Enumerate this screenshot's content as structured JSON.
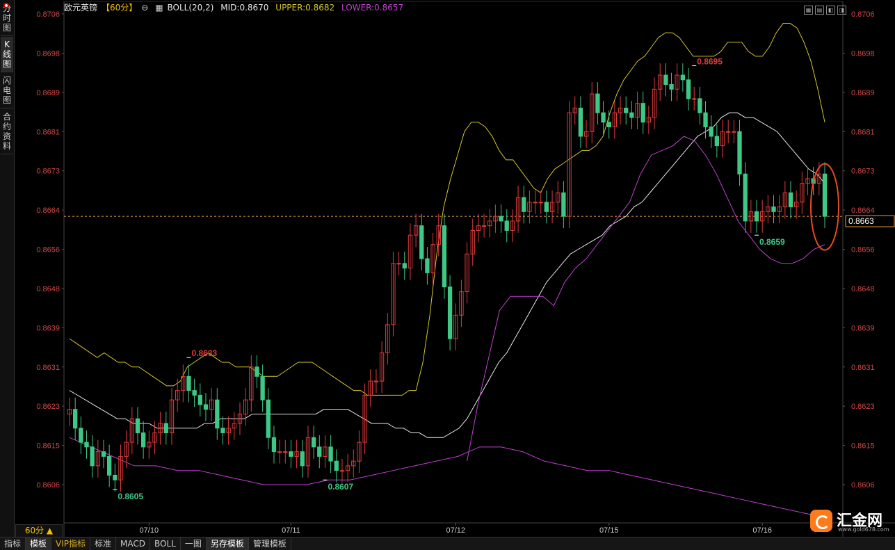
{
  "sidebar": {
    "tabs": [
      {
        "label": "分时图"
      },
      {
        "label": "K线图",
        "active": true
      },
      {
        "label": "闪电图"
      },
      {
        "label": "合约资料"
      }
    ]
  },
  "header": {
    "title": "欧元英镑",
    "period": "【60分】",
    "indicator": "BOLL(20,2)",
    "mid": "MID:0.8670",
    "upper": "UPPER:0.8682",
    "lower": "LOWER:0.8657"
  },
  "period_box": "60分 ▲",
  "bottom_tabs": [
    {
      "label": "指标",
      "selected": false
    },
    {
      "label": "模板",
      "selected": true
    },
    {
      "label": "VIP指标",
      "vip": true
    },
    {
      "label": "标准",
      "selected": false
    },
    {
      "label": "MACD",
      "selected": false
    },
    {
      "label": "BOLL",
      "selected": false
    },
    {
      "label": "一图",
      "selected": false
    },
    {
      "label": "另存模板",
      "selected": true
    },
    {
      "label": "管理模板",
      "selected": false
    }
  ],
  "logo": {
    "text": "汇金网",
    "url": "www.gold678.com"
  },
  "colors": {
    "up": "#e03c3c",
    "down": "#3ec886",
    "upper": "#d6c62a",
    "mid": "#e8e8e8",
    "lower": "#c040d0",
    "axis_text": "#d04848",
    "current_line": "#f0a040",
    "highlight": "#e84a20"
  },
  "chart_data": {
    "type": "candlestick",
    "title": "欧元英镑【60分】",
    "ylim": [
      0.86,
      0.8707
    ],
    "y_ticks": [
      "0.8706",
      "0.8698",
      "0.8689",
      "0.8681",
      "0.8673",
      "0.8664",
      "0.8656",
      "0.8648",
      "0.8639",
      "0.8631",
      "0.8623",
      "0.8615",
      "0.8606"
    ],
    "x_labels": [
      "07/10",
      "07/11",
      "07/12",
      "07/15",
      "07/16"
    ],
    "x_label_index": [
      14,
      39,
      68,
      95,
      122
    ],
    "current_price": "0.8663",
    "current_value": 0.8663,
    "annotations": [
      {
        "text": "0.8605",
        "index": 8,
        "value": 0.8605,
        "kind": "low"
      },
      {
        "text": "0.8633",
        "index": 21,
        "value": 0.8633,
        "kind": "high"
      },
      {
        "text": "0.8607",
        "index": 45,
        "value": 0.8607,
        "kind": "low"
      },
      {
        "text": "0.8695",
        "index": 110,
        "value": 0.8695,
        "kind": "high"
      },
      {
        "text": "0.8659",
        "index": 121,
        "value": 0.8659,
        "kind": "low"
      }
    ],
    "open": [
      0.8621,
      0.8622,
      0.8618,
      0.8615,
      0.8614,
      0.861,
      0.8613,
      0.8612,
      0.8608,
      0.8607,
      0.8612,
      0.8615,
      0.862,
      0.8617,
      0.8614,
      0.8615,
      0.8617,
      0.8619,
      0.8617,
      0.8624,
      0.8626,
      0.8629,
      0.8626,
      0.8625,
      0.8623,
      0.8622,
      0.8624,
      0.8618,
      0.8617,
      0.8618,
      0.8619,
      0.8621,
      0.8624,
      0.8631,
      0.8629,
      0.8624,
      0.8616,
      0.8613,
      0.8613,
      0.8613,
      0.8612,
      0.8613,
      0.861,
      0.8616,
      0.8614,
      0.8612,
      0.8614,
      0.8611,
      0.8609,
      0.8609,
      0.861,
      0.8611,
      0.8615,
      0.8625,
      0.8628,
      0.8628,
      0.8634,
      0.864,
      0.8653,
      0.8653,
      0.8652,
      0.8659,
      0.8661,
      0.8654,
      0.8651,
      0.8657,
      0.8661,
      0.8648,
      0.8637,
      0.8642,
      0.8647,
      0.8655,
      0.866,
      0.8661,
      0.8661,
      0.8662,
      0.8663,
      0.8662,
      0.866,
      0.8662,
      0.8667,
      0.8664,
      0.8666,
      0.8666,
      0.8666,
      0.8664,
      0.8666,
      0.8668,
      0.8663,
      0.8685,
      0.8686,
      0.868,
      0.8681,
      0.8689,
      0.8685,
      0.8683,
      0.8682,
      0.8685,
      0.8686,
      0.8685,
      0.8684,
      0.8687,
      0.8683,
      0.8684,
      0.869,
      0.8693,
      0.8691,
      0.869,
      0.8693,
      0.8692,
      0.8688,
      0.8688,
      0.8685,
      0.8682,
      0.868,
      0.8678,
      0.8681,
      0.8681,
      0.8681,
      0.8672,
      0.8662,
      0.8664,
      0.8662,
      0.8664,
      0.8665,
      0.8664,
      0.8665,
      0.8668,
      0.8665,
      0.8666,
      0.867,
      0.8671,
      0.867,
      0.8672
    ],
    "close": [
      0.8622,
      0.8618,
      0.8615,
      0.8614,
      0.861,
      0.8613,
      0.8612,
      0.8608,
      0.8607,
      0.8612,
      0.8615,
      0.862,
      0.8617,
      0.8614,
      0.8615,
      0.8617,
      0.8619,
      0.8617,
      0.8624,
      0.8626,
      0.8629,
      0.8626,
      0.8625,
      0.8623,
      0.8622,
      0.8624,
      0.8618,
      0.8617,
      0.8618,
      0.8619,
      0.8621,
      0.8624,
      0.8631,
      0.8629,
      0.8624,
      0.8616,
      0.8613,
      0.8613,
      0.8613,
      0.8612,
      0.8613,
      0.861,
      0.8616,
      0.8614,
      0.8612,
      0.8614,
      0.8611,
      0.8609,
      0.8609,
      0.861,
      0.8611,
      0.8615,
      0.8625,
      0.8628,
      0.8628,
      0.8634,
      0.864,
      0.8653,
      0.8653,
      0.8652,
      0.8659,
      0.8661,
      0.8654,
      0.8651,
      0.8657,
      0.8661,
      0.8648,
      0.8637,
      0.8642,
      0.8647,
      0.8655,
      0.866,
      0.8661,
      0.8661,
      0.8662,
      0.8663,
      0.8662,
      0.866,
      0.8662,
      0.8667,
      0.8664,
      0.8666,
      0.8666,
      0.8666,
      0.8664,
      0.8666,
      0.8668,
      0.8663,
      0.8685,
      0.8686,
      0.868,
      0.8681,
      0.8689,
      0.8685,
      0.8683,
      0.8682,
      0.8685,
      0.8686,
      0.8685,
      0.8684,
      0.8687,
      0.8683,
      0.8684,
      0.869,
      0.8693,
      0.8691,
      0.869,
      0.8693,
      0.8692,
      0.8688,
      0.8688,
      0.8685,
      0.8682,
      0.868,
      0.8678,
      0.8681,
      0.8681,
      0.8681,
      0.8672,
      0.8662,
      0.8664,
      0.8662,
      0.8664,
      0.8665,
      0.8664,
      0.8665,
      0.8668,
      0.8665,
      0.8666,
      0.867,
      0.8671,
      0.867,
      0.8672,
      0.8663
    ],
    "upper": [
      0.8637,
      0.8636,
      0.8635,
      0.8634,
      0.8633,
      0.8634,
      0.8633,
      0.8632,
      0.8632,
      0.8631,
      0.8631,
      0.863,
      0.8629,
      0.8628,
      0.8627,
      0.8627,
      0.8628,
      0.8631,
      0.8632,
      0.8633,
      0.8634,
      0.8633,
      0.8632,
      0.8632,
      0.8631,
      0.8631,
      0.8631,
      0.863,
      0.8629,
      0.8629,
      0.8629,
      0.863,
      0.8631,
      0.8632,
      0.8632,
      0.8632,
      0.8631,
      0.863,
      0.8629,
      0.8628,
      0.8627,
      0.8626,
      0.8626,
      0.8625,
      0.8625,
      0.8625,
      0.8625,
      0.8625,
      0.8625,
      0.8626,
      0.8626,
      0.8632,
      0.8642,
      0.8655,
      0.8665,
      0.8671,
      0.8676,
      0.8681,
      0.8683,
      0.8683,
      0.8682,
      0.868,
      0.8677,
      0.8675,
      0.8675,
      0.8673,
      0.8671,
      0.8669,
      0.8668,
      0.8671,
      0.8673,
      0.8674,
      0.8675,
      0.8676,
      0.8677,
      0.8677,
      0.8678,
      0.868,
      0.8685,
      0.8689,
      0.8692,
      0.8694,
      0.8696,
      0.8697,
      0.8699,
      0.8701,
      0.8702,
      0.8702,
      0.8701,
      0.8699,
      0.8697,
      0.8697,
      0.8697,
      0.8697,
      0.8698,
      0.87,
      0.87,
      0.87,
      0.8698,
      0.8697,
      0.8697,
      0.8699,
      0.8702,
      0.8704,
      0.8704,
      0.8703,
      0.87,
      0.8696,
      0.869,
      0.8683
    ],
    "mid": [
      0.8626,
      0.8625,
      0.8624,
      0.8623,
      0.8622,
      0.8621,
      0.862,
      0.862,
      0.8619,
      0.8619,
      0.8619,
      0.8618,
      0.8618,
      0.8618,
      0.8618,
      0.8618,
      0.8618,
      0.8619,
      0.8619,
      0.862,
      0.862,
      0.862,
      0.862,
      0.8621,
      0.8621,
      0.8621,
      0.8621,
      0.8621,
      0.8621,
      0.8621,
      0.8621,
      0.8621,
      0.8622,
      0.8622,
      0.8622,
      0.8622,
      0.8621,
      0.862,
      0.8619,
      0.8619,
      0.8619,
      0.8618,
      0.8618,
      0.8617,
      0.8617,
      0.8616,
      0.8616,
      0.8616,
      0.8617,
      0.8618,
      0.862,
      0.8623,
      0.8626,
      0.8629,
      0.8632,
      0.8634,
      0.8637,
      0.864,
      0.8643,
      0.8646,
      0.8649,
      0.8651,
      0.8653,
      0.8655,
      0.8656,
      0.8657,
      0.8658,
      0.8659,
      0.8661,
      0.8662,
      0.8663,
      0.8665,
      0.8666,
      0.8668,
      0.867,
      0.8672,
      0.8674,
      0.8676,
      0.8678,
      0.868,
      0.8681,
      0.8682,
      0.8684,
      0.8685,
      0.8685,
      0.8684,
      0.8684,
      0.8683,
      0.8682,
      0.8681,
      0.8679,
      0.8677,
      0.8675,
      0.8673,
      0.8672,
      0.867
    ],
    "lower": [
      0.8616,
      0.8614,
      0.8612,
      0.861,
      0.861,
      0.8609,
      0.8609,
      0.8608,
      0.8607,
      0.8606,
      0.8606,
      0.8606,
      0.8607,
      0.8607,
      0.8608,
      0.8609,
      0.861,
      0.8611,
      0.8612,
      0.8614,
      0.8614,
      0.8613,
      0.8611,
      0.861,
      0.8609,
      0.8609,
      0.8608,
      0.8607,
      0.8606,
      0.8605,
      0.8604,
      0.8603,
      0.8602,
      0.8601,
      0.86,
      0.8599,
      0.8611,
      0.8623,
      0.8633,
      0.8643,
      0.8646,
      0.8646,
      0.8646,
      0.8646,
      0.8644,
      0.8649,
      0.8652,
      0.8654,
      0.8657,
      0.866,
      0.8663,
      0.8666,
      0.8672,
      0.8676,
      0.8677,
      0.8678,
      0.868,
      0.8679,
      0.8676,
      0.8672,
      0.8667,
      0.8662,
      0.8659,
      0.8656,
      0.8654,
      0.8653,
      0.8653,
      0.8654,
      0.8656,
      0.8657
    ]
  }
}
